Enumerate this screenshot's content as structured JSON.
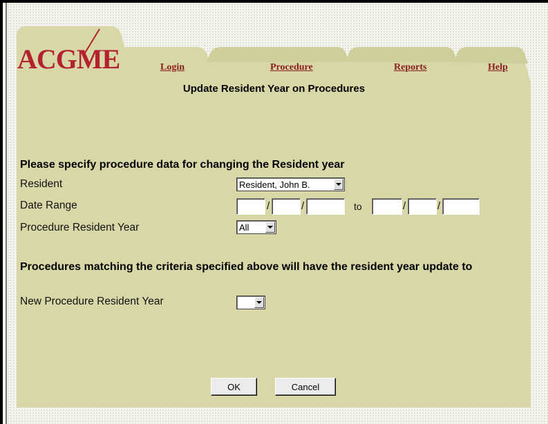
{
  "brand": {
    "logo_text": "ACGME"
  },
  "nav": {
    "login": "Login",
    "procedure": "Procedure",
    "reports": "Reports",
    "help": "Help"
  },
  "page_title": "Update Resident Year on Procedures",
  "criteria": {
    "heading": "Please specify procedure data for changing the Resident year",
    "resident_label": "Resident",
    "resident_value": "Resident, John B.",
    "date_range_label": "Date Range",
    "to_text": "to",
    "slash": "/",
    "proc_year_label": "Procedure Resident Year",
    "proc_year_value": "All"
  },
  "update": {
    "heading": "Procedures matching the criteria specified above will have the resident year update to",
    "new_year_label": "New Procedure Resident Year",
    "new_year_value": ""
  },
  "buttons": {
    "ok": "OK",
    "cancel": "Cancel"
  },
  "colors": {
    "panel": "#d6d6a6",
    "link": "#8b1e1e",
    "logo": "#b3222e"
  }
}
